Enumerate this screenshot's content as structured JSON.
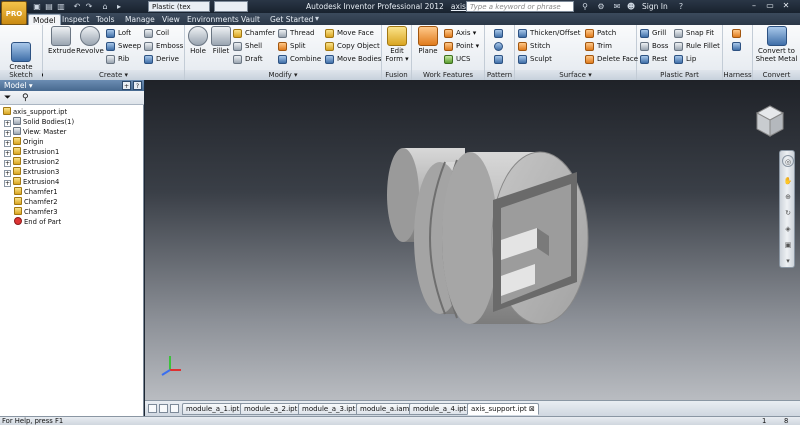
{
  "app": {
    "button_label": "PRO",
    "window_title": "Autodesk Inventor Professional 2012",
    "document_name": "axis_support.ipt",
    "search_placeholder": "Type a keyword or phrase",
    "sign_in_label": "Sign In",
    "material_value": "Plastic (tex"
  },
  "quick_access": [
    "▣",
    "▤",
    "▥",
    "↶",
    "↷",
    "⌂",
    "▸"
  ],
  "tabs": [
    {
      "label": "Model",
      "active": true
    },
    {
      "label": "Inspect",
      "active": false
    },
    {
      "label": "Tools",
      "active": false
    },
    {
      "label": "Manage",
      "active": false
    },
    {
      "label": "View",
      "active": false
    },
    {
      "label": "Environments",
      "active": false
    },
    {
      "label": "Vault",
      "active": false
    },
    {
      "label": "Get Started",
      "active": false
    }
  ],
  "ribbon": {
    "sketch": {
      "label": "Sketch",
      "create_2d": "Create\n2D Sketch ▾"
    },
    "create": {
      "label": "Create ▾",
      "extrude": "Extrude",
      "revolve": "Revolve",
      "loft": "Loft",
      "sweep": "Sweep",
      "rib": "Rib",
      "coil": "Coil",
      "emboss": "Emboss",
      "derive": "Derive"
    },
    "modify": {
      "label": "Modify ▾",
      "hole": "Hole",
      "fillet": "Fillet",
      "chamfer": "Chamfer",
      "shell": "Shell",
      "draft": "Draft",
      "thread": "Thread",
      "split": "Split",
      "combine": "Combine",
      "move_face": "Move Face",
      "copy_object": "Copy Object",
      "move_bodies": "Move Bodies"
    },
    "fusion": {
      "label": "Fusion",
      "edit_form": "Edit\nForm ▾"
    },
    "work_features": {
      "label": "Work Features",
      "plane": "Plane",
      "axis": "Axis ▾",
      "point": "Point ▾",
      "ucs": "UCS"
    },
    "pattern": {
      "label": "Pattern"
    },
    "surface": {
      "label": "Surface ▾",
      "thicken": "Thicken/Offset",
      "stitch": "Stitch",
      "sculpt": "Sculpt",
      "patch": "Patch",
      "trim": "Trim",
      "delete_face": "Delete Face"
    },
    "plastic_part": {
      "label": "Plastic Part",
      "grill": "Grill",
      "boss": "Boss",
      "rest": "Rest",
      "snap_fit": "Snap Fit",
      "rule_fillet": "Rule Fillet",
      "lip": "Lip"
    },
    "harness": {
      "label": "Harness"
    },
    "convert": {
      "label": "Convert",
      "sheet_metal": "Convert to\nSheet Metal"
    }
  },
  "browser": {
    "title": "Model ▾",
    "nodes": [
      {
        "label": "axis_support.ipt",
        "icon": "part-icon",
        "indent": 0,
        "expand": ""
      },
      {
        "label": "Solid Bodies(1)",
        "icon": "solid-bodies-icon",
        "indent": 1,
        "expand": "+"
      },
      {
        "label": "View: Master",
        "icon": "view-icon",
        "indent": 1,
        "expand": "+"
      },
      {
        "label": "Origin",
        "icon": "origin-folder-icon",
        "indent": 1,
        "expand": "+"
      },
      {
        "label": "Extrusion1",
        "icon": "extrusion-icon",
        "indent": 1,
        "expand": "+"
      },
      {
        "label": "Extrusion2",
        "icon": "extrusion-icon",
        "indent": 1,
        "expand": "+"
      },
      {
        "label": "Extrusion3",
        "icon": "extrusion-icon",
        "indent": 1,
        "expand": "+"
      },
      {
        "label": "Extrusion4",
        "icon": "extrusion-icon",
        "indent": 1,
        "expand": "+"
      },
      {
        "label": "Chamfer1",
        "icon": "chamfer-icon",
        "indent": 1,
        "expand": ""
      },
      {
        "label": "Chamfer2",
        "icon": "chamfer-icon",
        "indent": 1,
        "expand": ""
      },
      {
        "label": "Chamfer3",
        "icon": "chamfer-icon",
        "indent": 1,
        "expand": ""
      },
      {
        "label": "End of Part",
        "icon": "end-of-part-icon",
        "indent": 1,
        "expand": ""
      }
    ]
  },
  "doc_tabs": [
    {
      "label": "module_a_1.ipt",
      "active": false
    },
    {
      "label": "module_a_2.ipt",
      "active": false
    },
    {
      "label": "module_a_3.ipt",
      "active": false
    },
    {
      "label": "module_a.iam",
      "active": false
    },
    {
      "label": "module_a_4.ipt",
      "active": false
    },
    {
      "label": "axis_support.ipt ⊠",
      "active": true
    }
  ],
  "status": {
    "help_text": "For Help, press F1",
    "count_a": "1",
    "count_b": "8"
  },
  "colors": {
    "accent": "#47698f",
    "viewport_top": "#1f2228",
    "viewport_bottom": "#b9bcc1"
  }
}
